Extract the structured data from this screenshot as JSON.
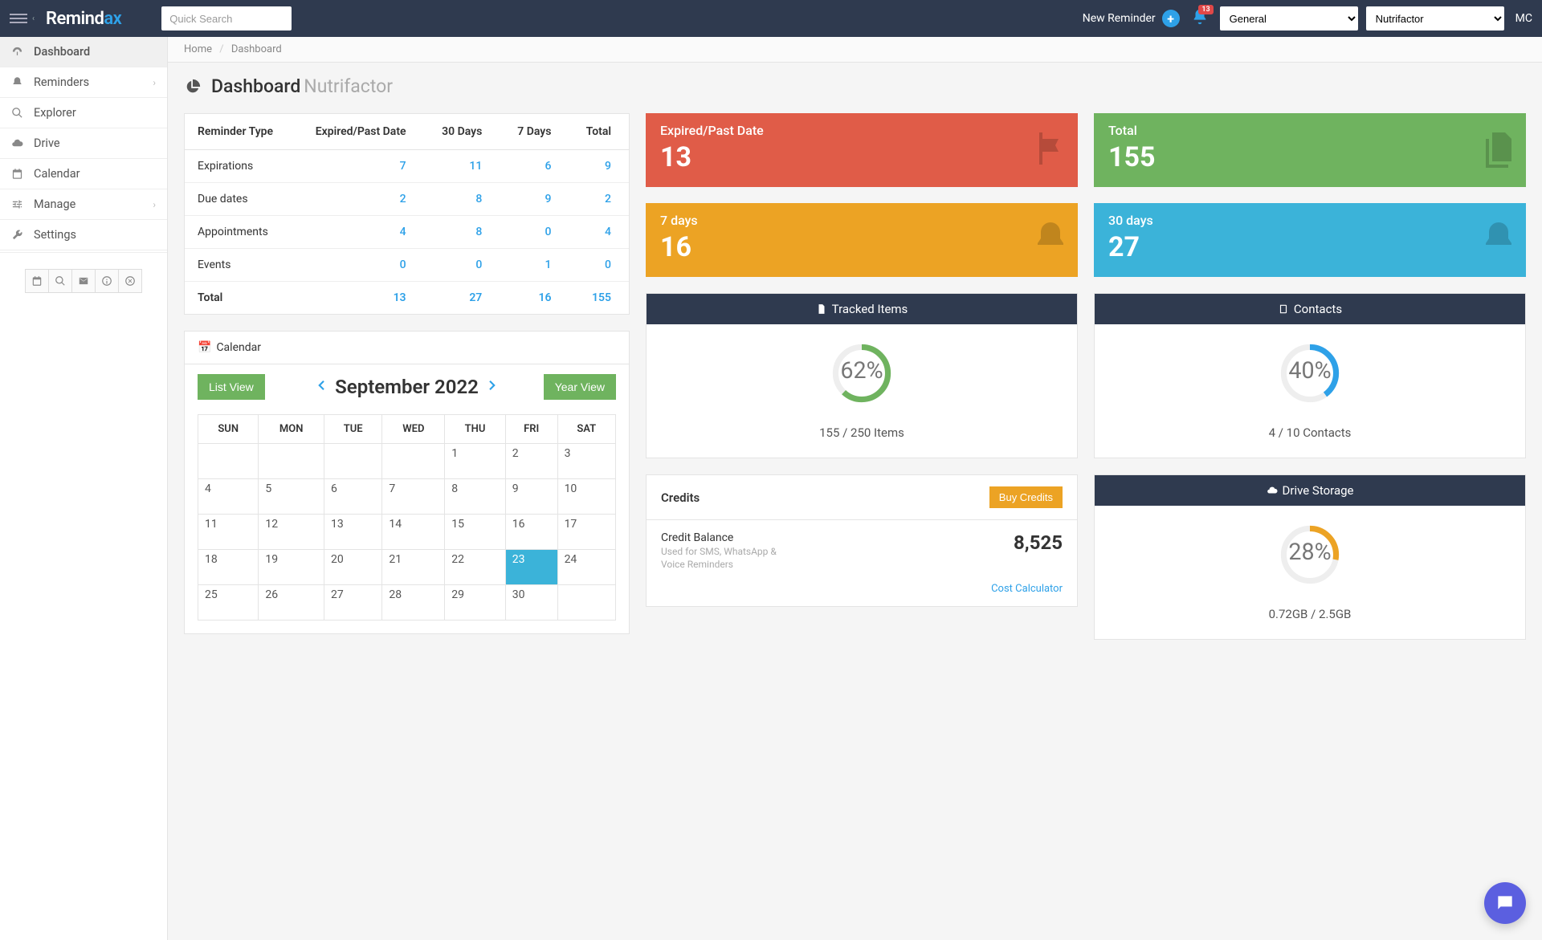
{
  "header": {
    "logo_prefix": "Remind",
    "logo_suffix": "ax",
    "search_placeholder": "Quick Search",
    "new_reminder": "New Reminder",
    "notif_count": "13",
    "select1": "General",
    "select2": "Nutrifactor",
    "avatar": "MC"
  },
  "sidebar": {
    "items": [
      {
        "label": "Dashboard",
        "icon": "dashboard",
        "active": true
      },
      {
        "label": "Reminders",
        "icon": "bell",
        "expand": true
      },
      {
        "label": "Explorer",
        "icon": "search"
      },
      {
        "label": "Drive",
        "icon": "cloud"
      },
      {
        "label": "Calendar",
        "icon": "calendar"
      },
      {
        "label": "Manage",
        "icon": "sliders",
        "expand": true
      },
      {
        "label": "Settings",
        "icon": "wrench"
      }
    ]
  },
  "breadcrumb": {
    "home": "Home",
    "current": "Dashboard"
  },
  "page": {
    "title": "Dashboard",
    "subtitle": "Nutrifactor"
  },
  "reminder_table": {
    "cols": [
      "Reminder Type",
      "Expired/Past Date",
      "30 Days",
      "7 Days",
      "Total"
    ],
    "rows": [
      {
        "label": "Expirations",
        "v": [
          "7",
          "11",
          "6",
          "9"
        ]
      },
      {
        "label": "Due dates",
        "v": [
          "2",
          "8",
          "9",
          "2"
        ]
      },
      {
        "label": "Appointments",
        "v": [
          "4",
          "8",
          "0",
          "4"
        ]
      },
      {
        "label": "Events",
        "v": [
          "0",
          "0",
          "1",
          "0"
        ]
      }
    ],
    "total_label": "Total",
    "totals": [
      "13",
      "27",
      "16",
      "155"
    ]
  },
  "cards": {
    "expired": {
      "label": "Expired/Past Date",
      "value": "13"
    },
    "total": {
      "label": "Total",
      "value": "155"
    },
    "days7": {
      "label": "7 days",
      "value": "16"
    },
    "days30": {
      "label": "30 days",
      "value": "27"
    }
  },
  "calendar": {
    "panel_title": "Calendar",
    "list_btn": "List View",
    "year_btn": "Year View",
    "month": "September 2022",
    "dow": [
      "SUN",
      "MON",
      "TUE",
      "WED",
      "THU",
      "FRI",
      "SAT"
    ],
    "weeks": [
      [
        "",
        "",
        "",
        "",
        "1",
        "2",
        "3"
      ],
      [
        "4",
        "5",
        "6",
        "7",
        "8",
        "9",
        "10"
      ],
      [
        "11",
        "12",
        "13",
        "14",
        "15",
        "16",
        "17"
      ],
      [
        "18",
        "19",
        "20",
        "21",
        "22",
        "23",
        "24"
      ],
      [
        "25",
        "26",
        "27",
        "28",
        "29",
        "30",
        ""
      ]
    ],
    "today": "23"
  },
  "tracked": {
    "title": "Tracked Items",
    "pct": 62,
    "label": "155 / 250 Items"
  },
  "contacts": {
    "title": "Contacts",
    "pct": 40,
    "label": "4 / 10 Contacts"
  },
  "credits": {
    "title": "Credits",
    "buy": "Buy Credits",
    "balance_label": "Credit Balance",
    "note": "Used for SMS, WhatsApp & Voice Reminders",
    "balance": "8,525",
    "cost_calc": "Cost Calculator"
  },
  "storage": {
    "title": "Drive Storage",
    "pct": 28,
    "label": "0.72GB / 2.5GB"
  },
  "chart_data": [
    {
      "type": "table",
      "title": "Reminder Type",
      "columns": [
        "Reminder Type",
        "Expired/Past Date",
        "30 Days",
        "7 Days",
        "Total"
      ],
      "rows": [
        [
          "Expirations",
          7,
          11,
          6,
          9
        ],
        [
          "Due dates",
          2,
          8,
          9,
          2
        ],
        [
          "Appointments",
          4,
          8,
          0,
          4
        ],
        [
          "Events",
          0,
          0,
          1,
          0
        ],
        [
          "Total",
          13,
          27,
          16,
          155
        ]
      ]
    },
    {
      "type": "pie",
      "title": "Tracked Items",
      "values": [
        62,
        38
      ],
      "categories": [
        "used",
        "remaining"
      ]
    },
    {
      "type": "pie",
      "title": "Contacts",
      "values": [
        40,
        60
      ],
      "categories": [
        "used",
        "remaining"
      ]
    },
    {
      "type": "pie",
      "title": "Drive Storage",
      "values": [
        28,
        72
      ],
      "categories": [
        "used",
        "remaining"
      ]
    }
  ]
}
